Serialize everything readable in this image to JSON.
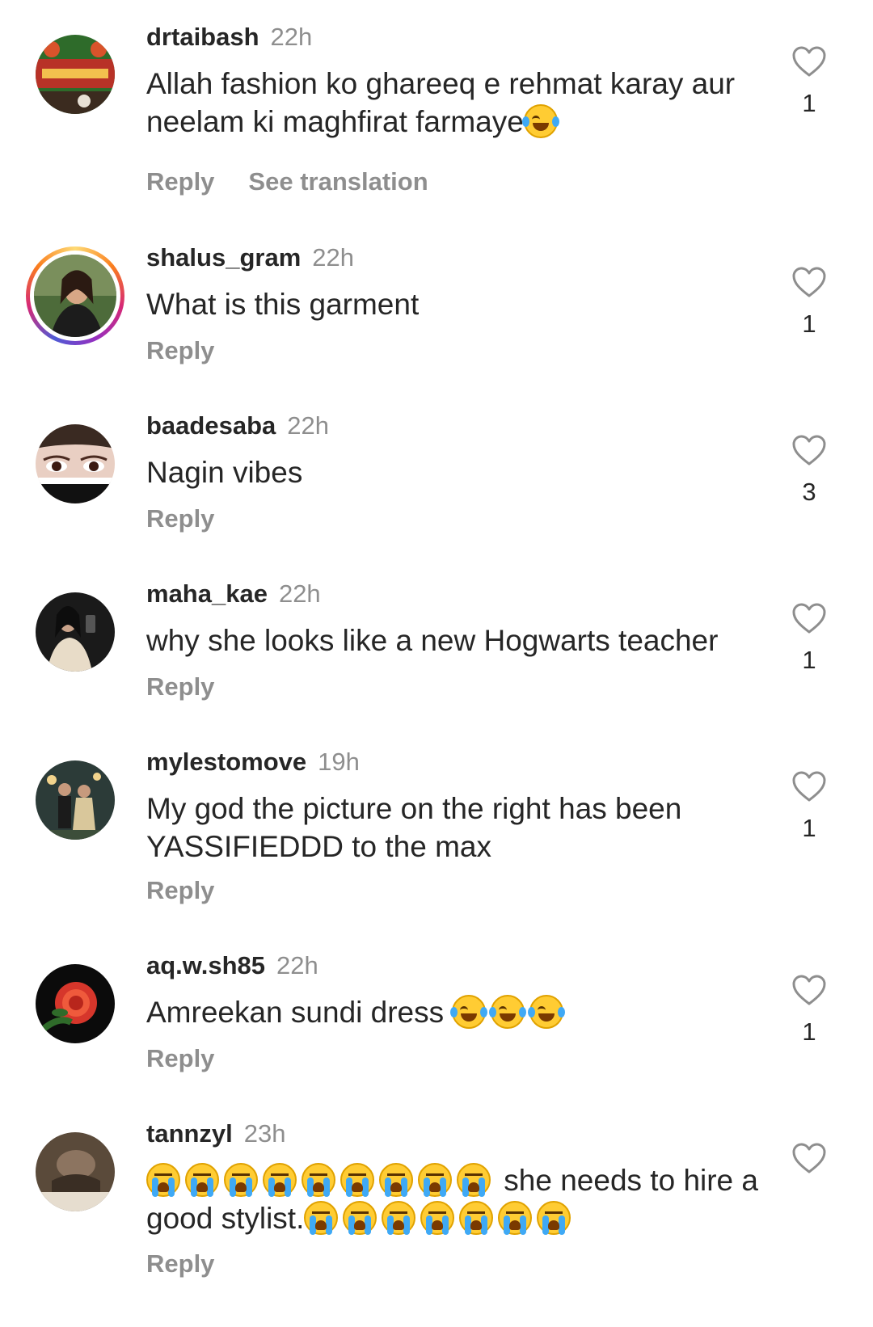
{
  "colors": {
    "text": "#262626",
    "muted": "#8e8e8e",
    "story_ring": [
      "#feda75",
      "#fa7e1e",
      "#d62976",
      "#962fbf",
      "#4f5bd5"
    ]
  },
  "icons": {
    "like": "heart-outline-icon",
    "laugh_emoji": "face-with-tears-of-joy",
    "cry_emoji": "loudly-crying-face"
  },
  "comments": [
    {
      "username": "drtaibash",
      "time": "22h",
      "text": "Allah fashion ko ghareeq e rehmat karay aur neelam ki maghfirat farmaye",
      "emoji_suffix": "laugh",
      "reply": "Reply",
      "translate": "See translation",
      "likes": "1"
    },
    {
      "username": "shalus_gram",
      "time": "22h",
      "text": "What is this garment",
      "reply": "Reply",
      "likes": "1"
    },
    {
      "username": "baadesaba",
      "time": "22h",
      "text": "Nagin vibes",
      "reply": "Reply",
      "likes": "3"
    },
    {
      "username": "maha_kae",
      "time": "22h",
      "text": "why she looks like a new Hogwarts teacher",
      "reply": "Reply",
      "likes": "1"
    },
    {
      "username": "mylestomove",
      "time": "19h",
      "text": "My god the picture on the right has been YASSIFIEDDD to the max",
      "reply": "Reply",
      "likes": "1"
    },
    {
      "username": "aq.w.sh85",
      "time": "22h",
      "text": "Amreekan sundi dress ",
      "reply": "Reply",
      "likes": "1"
    },
    {
      "username": "tannzyl",
      "time": "23h",
      "text_after": " she needs to hire a good stylist.",
      "reply": "Reply"
    }
  ]
}
